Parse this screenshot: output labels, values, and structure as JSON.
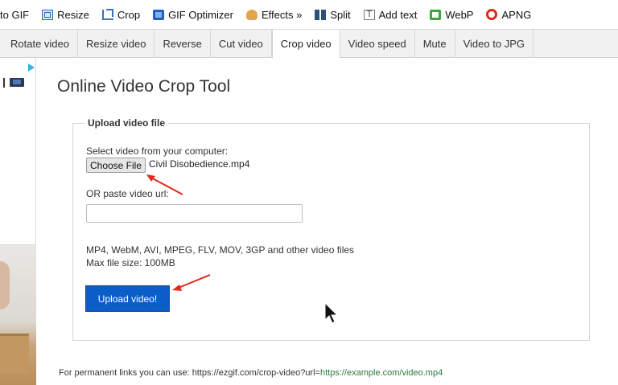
{
  "toolbar": {
    "items": [
      {
        "label": "to GIF",
        "icon": null
      },
      {
        "label": "Resize",
        "icon": "resize-icon"
      },
      {
        "label": "Crop",
        "icon": "crop-icon"
      },
      {
        "label": "GIF Optimizer",
        "icon": "gif-optimizer-icon"
      },
      {
        "label": "Effects »",
        "icon": "effects-icon"
      },
      {
        "label": "Split",
        "icon": "split-icon"
      },
      {
        "label": "Add text",
        "icon": "add-text-icon"
      },
      {
        "label": "WebP",
        "icon": "webp-icon"
      },
      {
        "label": "APNG",
        "icon": "apng-icon"
      }
    ]
  },
  "tabs": [
    {
      "label": "Rotate video",
      "active": false
    },
    {
      "label": "Resize video",
      "active": false
    },
    {
      "label": "Reverse",
      "active": false
    },
    {
      "label": "Cut video",
      "active": false
    },
    {
      "label": "Crop video",
      "active": true
    },
    {
      "label": "Video speed",
      "active": false
    },
    {
      "label": "Mute",
      "active": false
    },
    {
      "label": "Video to JPG",
      "active": false
    }
  ],
  "main": {
    "title": "Online Video Crop Tool",
    "upload": {
      "legend": "Upload video file",
      "select_label": "Select video from your computer:",
      "choose_button": "Choose File",
      "file_name": "Civil Disobedience.mp4",
      "url_label": "OR paste video url:",
      "url_value": "",
      "formats_line": "MP4, WebM, AVI, MPEG, FLV, MOV, 3GP and other video files",
      "max_size_line": "Max file size: 100MB",
      "upload_button": "Upload video!"
    },
    "footer": {
      "prefix": "For permanent links you can use: https://ezgif.com/crop-video?url=",
      "link": "https://example.com/video.mp4"
    }
  },
  "colors": {
    "accent": "#0b5ec7",
    "annotation_arrow": "#e0281b",
    "link": "#2a7a3c"
  }
}
